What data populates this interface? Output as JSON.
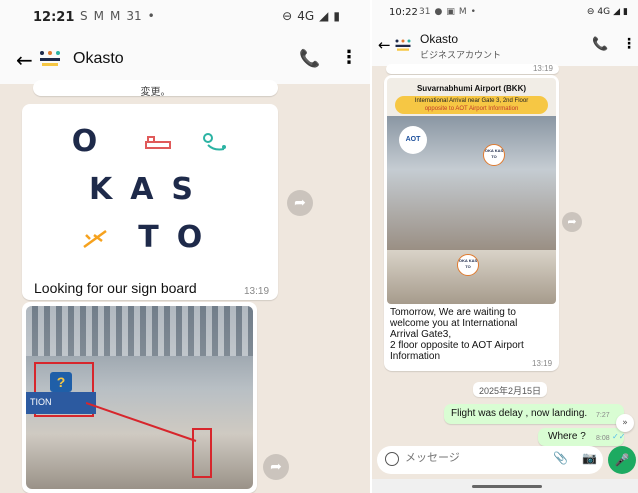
{
  "left": {
    "status": {
      "time": "12:21",
      "icons": [
        "S",
        "M",
        "M",
        "31",
        "•"
      ],
      "network": "4G"
    },
    "header": {
      "title": "Okasto"
    },
    "top_snippet": "変更。",
    "logo": {
      "row1": "O",
      "row2": "KAS",
      "row3": "TO"
    },
    "logo_caption": "Looking for our sign board",
    "logo_time": "13:19",
    "photo_sign": "?",
    "photo_label": "TION"
  },
  "right": {
    "status": {
      "time": "10:22",
      "icons": [
        "31",
        "●",
        "▣",
        "M",
        "•"
      ],
      "network": "4G"
    },
    "header": {
      "title": "Okasto",
      "subtitle": "ビジネスアカウント"
    },
    "top_time": "13:19",
    "airport": {
      "title": "Suvarnabhumi Airport (BKK)",
      "sub_line1": "International Arrival near Gate 3, 2nd Floor",
      "sub_line2": "opposite to AOT Airport Information",
      "aot": "AOT"
    },
    "message": "Tomorrow, We are waiting to welcome you at International Arrival Gate3,\n2 floor opposite to AOT Airport Information",
    "message_time": "13:19",
    "date_chip": "2025年2月15日",
    "out1": {
      "text": "Flight was delay , now landing.",
      "time": "7:27"
    },
    "out2": {
      "text": "Where ?",
      "time": "8:08"
    },
    "input_placeholder": "メッセージ"
  },
  "colors": {
    "chat_bg": "#efe7de",
    "outgoing": "#d9fdd3",
    "mic": "#1daa61",
    "tick": "#53bdeb"
  }
}
